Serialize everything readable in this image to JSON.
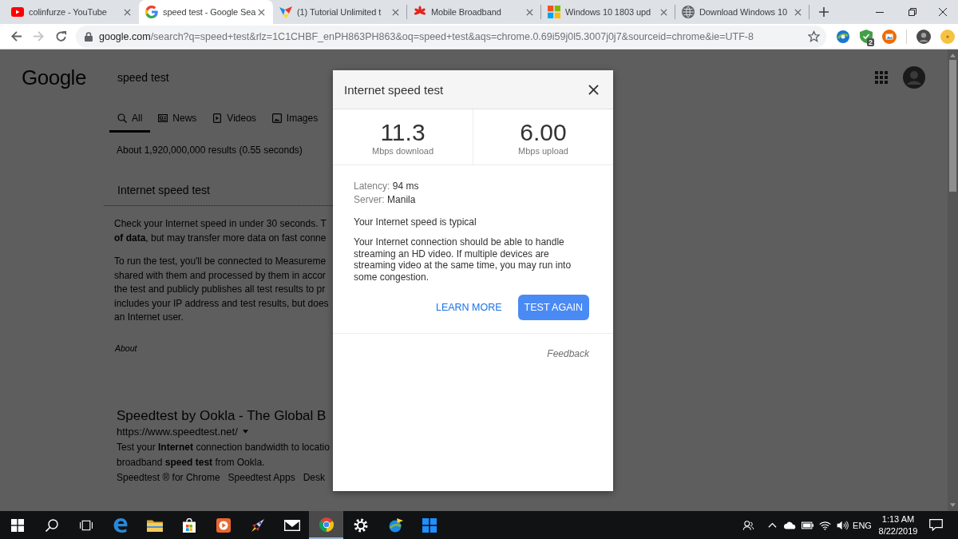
{
  "browser": {
    "tabs": [
      {
        "title": "colinfurze - YouTube",
        "selected": false
      },
      {
        "title": "speed test - Google Sea",
        "selected": true
      },
      {
        "title": "(1) Tutorial Unlimited t",
        "selected": false
      },
      {
        "title": "Mobile Broadband",
        "selected": false
      },
      {
        "title": "Windows 10 1803 upd",
        "selected": false
      },
      {
        "title": "Download Windows 10",
        "selected": false
      }
    ],
    "nav": [
      {
        "kind": "back",
        "disabled": false
      },
      {
        "kind": "forward",
        "disabled": true
      },
      {
        "kind": "reload",
        "disabled": false
      }
    ],
    "address": {
      "host": "google.com",
      "path": "/search?q=speed+test&rlz=1C1CHBF_enPH863PH863&oq=speed+test&aqs=chrome.0.69i59j0l5.3007j0j7&sourceid=chrome&ie=UTF-8"
    },
    "extension_badge": "2"
  },
  "page": {
    "logo": "Google",
    "query": "speed test",
    "search_tabs": [
      {
        "label": "All",
        "selected": true
      },
      {
        "label": "News",
        "selected": false
      },
      {
        "label": "Videos",
        "selected": false
      },
      {
        "label": "Images",
        "selected": false
      }
    ],
    "result_stats": "About 1,920,000,000 results (0.55 seconds)",
    "card": {
      "title": "Internet speed test",
      "paragraphs": [
        [
          "Check your Internet speed in under 30 seconds. T",
          "**of data**, but may transfer more data on fast conne"
        ],
        [
          "To run the test, you'll be connected to Measureme",
          "shared with them and processed by them in accor",
          "the test and publicly publishes all test results to pr",
          "includes your IP address and test results, but does",
          "an Internet user."
        ]
      ],
      "about": "About"
    },
    "result": {
      "title": "Speedtest by Ookla - The Global B",
      "url": "https://www.speedtest.net/",
      "snippet": [
        "Test your **Internet** connection bandwidth to locatio",
        "broadband **speed test** from Ookla."
      ],
      "sitelinks": [
        "Speedtest ® for Chrome",
        "Speedtest Apps",
        "Desk"
      ]
    }
  },
  "dialog": {
    "title": "Internet speed test",
    "results": [
      {
        "value": "11.3",
        "unit": "Mbps download"
      },
      {
        "value": "6.00",
        "unit": "Mbps upload"
      }
    ],
    "details": [
      {
        "label": "Latency:",
        "value": "94 ms"
      },
      {
        "label": "Server:",
        "value": "Manila"
      }
    ],
    "verdict": "Your Internet speed is typical",
    "description": "Your Internet connection should be able to handle streaming an HD video. If multiple devices are streaming video at the same time, you may run into some congestion.",
    "actions": [
      {
        "label": "LEARN MORE",
        "kind": "text"
      },
      {
        "label": "TEST AGAIN",
        "kind": "filled"
      }
    ],
    "feedback": "Feedback"
  },
  "taskbar": {
    "apps": [
      {
        "selected": false
      },
      {
        "selected": false
      },
      {
        "selected": false
      },
      {
        "selected": false
      },
      {
        "selected": false
      },
      {
        "selected": false
      },
      {
        "selected": true
      },
      {
        "selected": false
      },
      {
        "selected": false
      },
      {
        "selected": false
      }
    ],
    "language": "ENG",
    "time": "1:13 AM",
    "date": "8/22/2019"
  }
}
